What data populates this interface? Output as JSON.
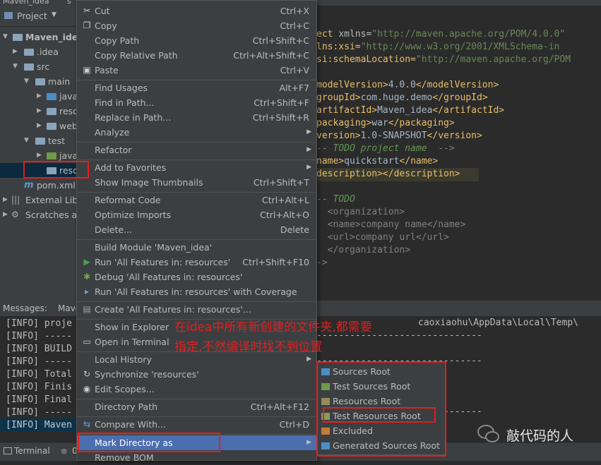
{
  "titlebar": {
    "project": "Maven_idea",
    "tab": "s"
  },
  "project_panel": {
    "header": "Project",
    "tree": [
      {
        "label": "Maven_idea",
        "bold": true
      },
      {
        "label": ".idea"
      },
      {
        "label": "src"
      },
      {
        "label": "main"
      },
      {
        "label": "java"
      },
      {
        "label": "reso"
      },
      {
        "label": "web"
      },
      {
        "label": "test"
      },
      {
        "label": "java"
      },
      {
        "label": "reso"
      },
      {
        "label": "pom.xml"
      },
      {
        "label": "External Libra"
      },
      {
        "label": "Scratches and"
      }
    ]
  },
  "editor": {
    "lines": [
      {
        "a": "ect ",
        "b": "xmlns=",
        "c": "\"http://maven.apache.org/POM/4.0.0\""
      },
      {
        "a": "lns:xsi=",
        "b": "",
        "c": "\"http://www.w3.org/2001/XMLSchema-in"
      },
      {
        "a": "si:schemaLocation=",
        "b": "",
        "c": "\"http://maven.apache.org/POM"
      },
      {
        "a": "modelVersion>",
        "b": "4.0.0",
        "c": "</modelVersion>"
      },
      {
        "a": "groupId>",
        "b": "com.huge.demo",
        "c": "</groupId>"
      },
      {
        "a": "artifactId>",
        "b": "Maven_idea",
        "c": "</artifactId>"
      },
      {
        "a": "packaging>",
        "b": "war",
        "c": "</packaging>"
      },
      {
        "a": "version>",
        "b": "1.0-SNAPSHOT",
        "c": "</version>"
      },
      {
        "a": "-- ",
        "b": "TODO project name",
        "c": "  -->"
      },
      {
        "a": "name>",
        "b": "quickstart",
        "c": "</name>"
      },
      {
        "a": "description>",
        "b": "",
        "c": "</description>"
      },
      {
        "a": "",
        "b": "",
        "c": ""
      },
      {
        "a": "-- ",
        "b": "TODO",
        "c": ""
      },
      {
        "a": "  <organization>",
        "b": "",
        "c": ""
      },
      {
        "a": "  <name>",
        "b": "company name",
        "c": "</name>"
      },
      {
        "a": "  <url>",
        "b": "company url",
        "c": "</url>"
      },
      {
        "a": "  </organization>",
        "b": "",
        "c": ""
      },
      {
        "a": "->",
        "b": "",
        "c": ""
      }
    ]
  },
  "bottom_panel": {
    "tab_messages": "Messages:",
    "tab_maven": "Mave",
    "path_fragment": "caoxiaohu\\AppData\\Local\\Temp\\",
    "log_lines": [
      "[INFO] proje",
      "[INFO] -----",
      "[INFO] BUILD",
      "[INFO] -----",
      "[INFO] Total",
      "[INFO] Finis",
      "[INFO] Final",
      "[INFO] -----",
      "[INFO] Maven"
    ],
    "dashes": "------------------------------"
  },
  "statusbar": {
    "terminal": "Terminal",
    "tab2": "0"
  },
  "context_menu": {
    "items": [
      {
        "label": "Cut",
        "shortcut": "Ctrl+X",
        "icon": "scissors-icon"
      },
      {
        "label": "Copy",
        "shortcut": "Ctrl+C",
        "icon": "copy-icon"
      },
      {
        "label": "Copy Path",
        "shortcut": "Ctrl+Shift+C"
      },
      {
        "label": "Copy Relative Path",
        "shortcut": "Ctrl+Alt+Shift+C"
      },
      {
        "label": "Paste",
        "shortcut": "Ctrl+V",
        "icon": "paste-icon"
      },
      {
        "label": "Find Usages",
        "shortcut": "Alt+F7"
      },
      {
        "label": "Find in Path...",
        "shortcut": "Ctrl+Shift+F"
      },
      {
        "label": "Replace in Path...",
        "shortcut": "Ctrl+Shift+R"
      },
      {
        "label": "Analyze",
        "shortcut": "",
        "submenu": true
      },
      {
        "label": "Refactor",
        "shortcut": "",
        "submenu": true
      },
      {
        "label": "Add to Favorites",
        "shortcut": "",
        "submenu": true
      },
      {
        "label": "Show Image Thumbnails",
        "shortcut": "Ctrl+Shift+T"
      },
      {
        "label": "Reformat Code",
        "shortcut": "Ctrl+Alt+L"
      },
      {
        "label": "Optimize Imports",
        "shortcut": "Ctrl+Alt+O"
      },
      {
        "label": "Delete...",
        "shortcut": "Delete"
      },
      {
        "label": "Build Module 'Maven_idea'",
        "shortcut": ""
      },
      {
        "label": "Run 'All Features in: resources'",
        "shortcut": "Ctrl+Shift+F10",
        "icon": "run-icon"
      },
      {
        "label": "Debug 'All Features in: resources'",
        "shortcut": "",
        "icon": "debug-icon"
      },
      {
        "label": "Run 'All Features in: resources' with Coverage",
        "shortcut": "",
        "icon": "coverage-icon"
      },
      {
        "label": "Create 'All Features in: resources'...",
        "shortcut": "",
        "icon": "create-config-icon"
      },
      {
        "label": "Show in Explorer",
        "shortcut": ""
      },
      {
        "label": "Open in Terminal",
        "shortcut": "",
        "icon": "terminal-icon"
      },
      {
        "label": "Local History",
        "shortcut": "",
        "submenu": true
      },
      {
        "label": "Synchronize 'resources'",
        "shortcut": "",
        "icon": "sync-icon"
      },
      {
        "label": "Edit Scopes...",
        "shortcut": "",
        "icon": "scope-icon"
      },
      {
        "label": "Directory Path",
        "shortcut": "Ctrl+Alt+F12"
      },
      {
        "label": "Compare With...",
        "shortcut": "Ctrl+D",
        "icon": "compare-icon"
      },
      {
        "label": "Mark Directory as",
        "shortcut": "",
        "submenu": true
      },
      {
        "label": "Remove BOM",
        "shortcut": ""
      }
    ]
  },
  "submenu": {
    "items": [
      {
        "label": "Sources Root",
        "color": "#4a8ec6"
      },
      {
        "label": "Test Sources Root",
        "color": "#6f9a4a"
      },
      {
        "label": "Resources Root",
        "color": "#9a8a5a"
      },
      {
        "label": "Test Resources Root",
        "color": "#8a9a5a"
      },
      {
        "label": "Excluded",
        "color": "#c57a3a"
      },
      {
        "label": "Generated Sources Root",
        "color": "#4a8ec6"
      }
    ]
  },
  "annotation": {
    "line1": "在idea中所有新创建的文件夹,都需要",
    "line2": "指定,不然编译时找不到位置"
  },
  "watermark": {
    "text": "敲代码的人"
  },
  "colors": {
    "highlight": "#4b6eaf",
    "annotation_red": "#e02020"
  }
}
